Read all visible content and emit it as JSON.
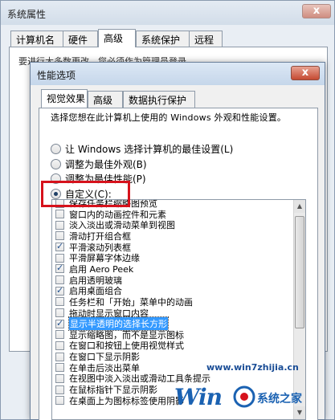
{
  "outer_window": {
    "title": "系统属性",
    "close_glyph": "x",
    "tabs": [
      "计算机名",
      "硬件",
      "高级",
      "系统保护",
      "远程"
    ],
    "active_tab": "高级",
    "partial_text": "要进行大多数更改，您必须作为管理员登录。"
  },
  "dialog": {
    "title": "性能选项",
    "close_glyph": "x",
    "tabs": [
      "视觉效果",
      "高级",
      "数据执行保护"
    ],
    "active_tab": "视觉效果",
    "description": "选择您想在此计算机上使用的 Windows 外观和性能设置。",
    "radio_options": [
      {
        "label": "让 Windows 选择计算机的最佳设置(L)",
        "checked": false
      },
      {
        "label": "调整为最佳外观(B)",
        "checked": false
      },
      {
        "label": "调整为最佳性能(P)",
        "checked": false
      },
      {
        "label": "自定义(C):",
        "checked": true
      }
    ],
    "effects": [
      {
        "label": "保存任务栏缩略图预览",
        "checked": false
      },
      {
        "label": "窗口内的动画控件和元素",
        "checked": false
      },
      {
        "label": "淡入淡出或滑动菜单到视图",
        "checked": false
      },
      {
        "label": "滑动打开组合框",
        "checked": false
      },
      {
        "label": "平滑滚动列表框",
        "checked": true
      },
      {
        "label": "平滑屏幕字体边缘",
        "checked": false
      },
      {
        "label": "启用 Aero Peek",
        "checked": true
      },
      {
        "label": "启用透明玻璃",
        "checked": false
      },
      {
        "label": "启用桌面组合",
        "checked": true
      },
      {
        "label": "任务栏和「开始」菜单中的动画",
        "checked": false
      },
      {
        "label": "拖动时显示窗口内容",
        "checked": false
      },
      {
        "label": "显示半透明的选择长方形",
        "checked": true,
        "selected": true
      },
      {
        "label": "显示缩略图，而不是显示图标",
        "checked": false
      },
      {
        "label": "在窗口和按钮上使用视觉样式",
        "checked": false
      },
      {
        "label": "在窗口下显示阴影",
        "checked": false
      },
      {
        "label": "在单击后淡出菜单",
        "checked": false
      },
      {
        "label": "在视图中淡入淡出或滑动工具条提示",
        "checked": false
      },
      {
        "label": "在鼠标指针下显示阴影",
        "checked": false
      },
      {
        "label": "在桌面上为图标标签使用阴影",
        "checked": false
      }
    ],
    "scrollbar": {
      "up_glyph": "▲",
      "down_glyph": "▼"
    }
  },
  "watermark": {
    "url": "www.win7zhijia.cn",
    "brand_prefix": "Win",
    "brand_name": "系统之家"
  },
  "colors": {
    "highlight_border": "#d6121c",
    "selection": "#3399ff",
    "brand_blue": "#1b62b2"
  }
}
